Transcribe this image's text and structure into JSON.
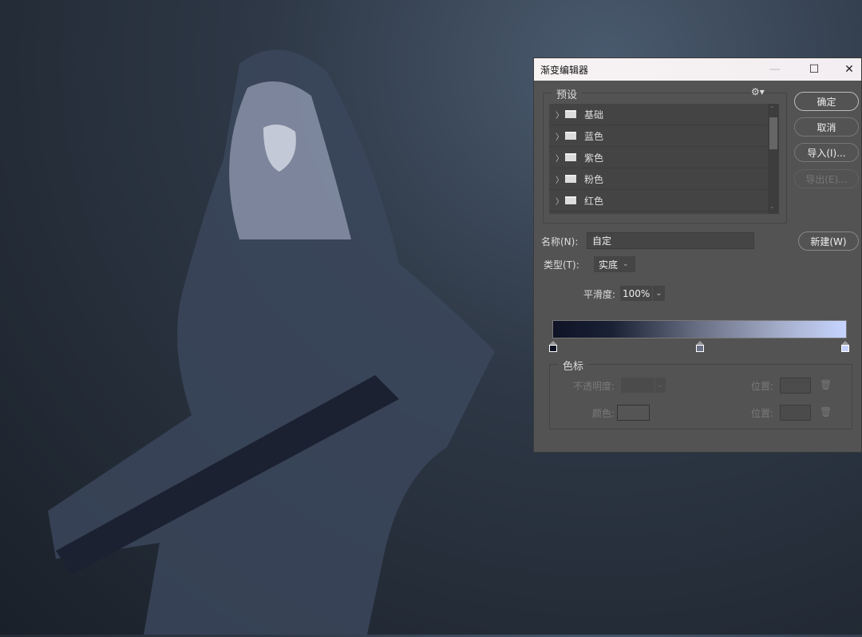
{
  "dialog": {
    "title": "渐变编辑器",
    "minimize_icon": "minimize-icon",
    "maximize_icon": "maximize-icon",
    "close_icon": "close-icon"
  },
  "presets": {
    "label": "预设",
    "items": [
      {
        "label": "基础"
      },
      {
        "label": "蓝色"
      },
      {
        "label": "紫色"
      },
      {
        "label": "粉色"
      },
      {
        "label": "红色"
      }
    ]
  },
  "buttons": {
    "ok": "确定",
    "cancel": "取消",
    "import": "导入(I)...",
    "export": "导出(E)...",
    "new": "新建(W)"
  },
  "name": {
    "label": "名称(N):",
    "value": "自定"
  },
  "type": {
    "label": "类型(T):",
    "value": "实底"
  },
  "smoothness": {
    "label": "平滑度:",
    "value": "100%"
  },
  "gradient": {
    "colors": [
      "#0f1426",
      "#6a7085",
      "#c6d4ff"
    ],
    "stops": [
      {
        "position": 0,
        "color": "#0f1426"
      },
      {
        "position": 50,
        "color": "#6a7085"
      },
      {
        "position": 100,
        "color": "#c6d4ff"
      }
    ]
  },
  "color_stops": {
    "label": "色标",
    "opacity_label": "不透明度:",
    "color_label": "颜色:",
    "position_label_1": "位置:",
    "position_label_2": "位置:"
  }
}
